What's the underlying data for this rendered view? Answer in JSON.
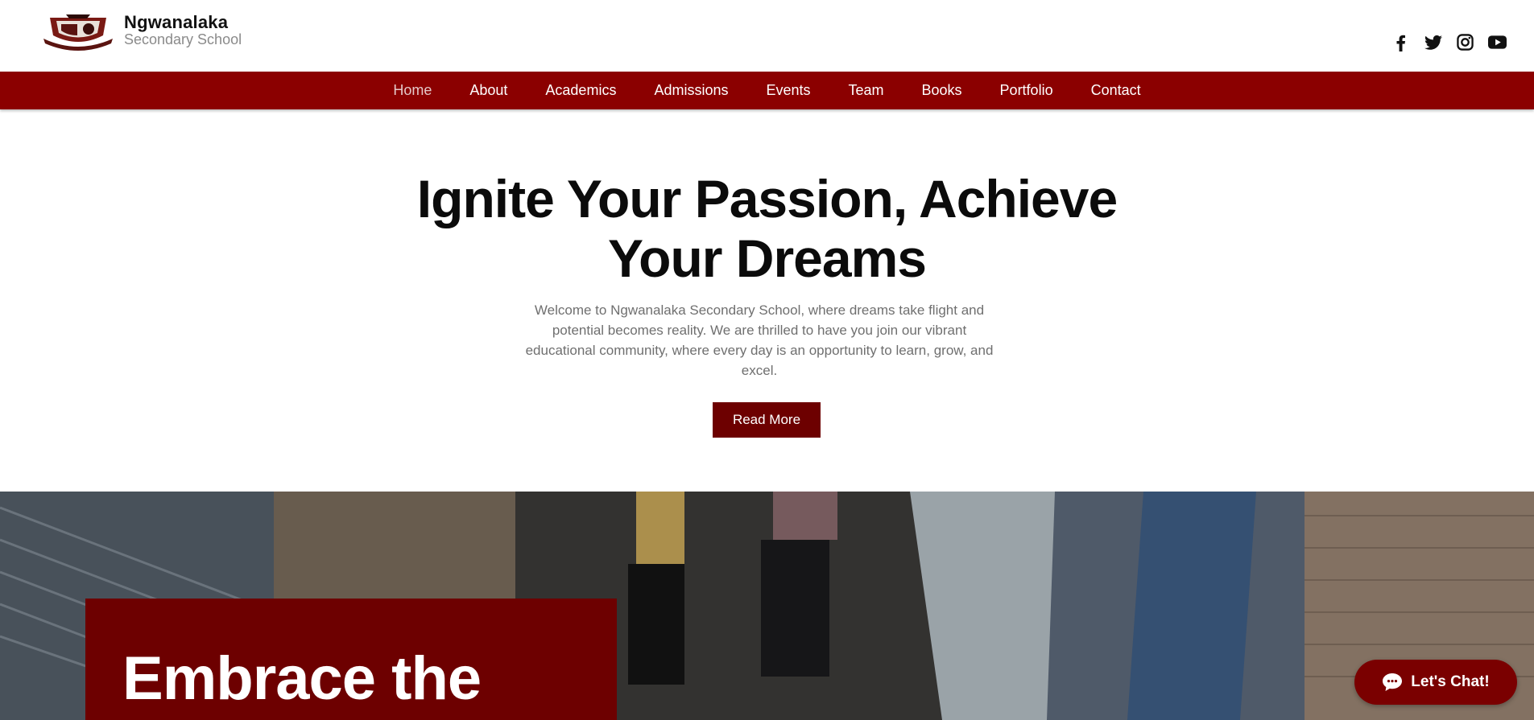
{
  "brand": {
    "name": "Ngwanalaka",
    "subtitle": "Secondary School"
  },
  "nav": {
    "items": [
      {
        "label": "Home",
        "active": true
      },
      {
        "label": "About"
      },
      {
        "label": "Academics"
      },
      {
        "label": "Admissions"
      },
      {
        "label": "Events"
      },
      {
        "label": "Team"
      },
      {
        "label": "Books"
      },
      {
        "label": "Portfolio"
      },
      {
        "label": "Contact"
      }
    ]
  },
  "socials": [
    "facebook-icon",
    "twitter-icon",
    "instagram-icon",
    "youtube-icon"
  ],
  "hero": {
    "title_line1": "Ignite Your Passion, Achieve",
    "title_line2": "Your Dreams",
    "text": "Welcome to Ngwanalaka Secondary School, where dreams take flight and potential becomes reality. We are thrilled to have you join our vibrant educational community, where every day is an opportunity to learn, grow, and excel.",
    "button_label": "Read More"
  },
  "feature": {
    "heading": "Embrace the"
  },
  "chat": {
    "label": "Let's Chat!"
  },
  "colors": {
    "brand": "#8b0000",
    "brand_dark": "#6d0000"
  }
}
